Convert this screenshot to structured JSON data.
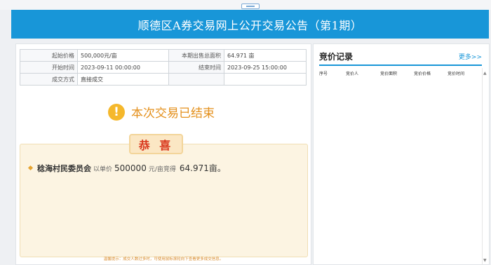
{
  "header": {
    "title": "顺德区A券交易网上公开交易公告（第1期）"
  },
  "info_table": {
    "rows": [
      {
        "label1": "起始价格",
        "value1": "500,000元/亩",
        "label2": "本期出售总面积",
        "value2": "64.971 亩"
      },
      {
        "label1": "开始时间",
        "value1": "2023-09-11 00:00:00",
        "label2": "结束时间",
        "value2": "2023-09-25 15:00:00"
      },
      {
        "label1": "成交方式",
        "value1": "直接成交",
        "label2": "",
        "value2": ""
      }
    ]
  },
  "status": {
    "icon": "warning-icon",
    "text": "本次交易已结束"
  },
  "congrats": {
    "title": "恭 喜",
    "winner": "稔海村民委员会",
    "prefix": "以单价",
    "price": "500000",
    "unit": "元/亩竞得",
    "area": "64.971亩。",
    "tip": "温馨提示：成交人数过多时，可使用鼠标滚轮向下查看更多成交信息。"
  },
  "bid_records": {
    "title": "竞价记录",
    "more": "更多>>",
    "columns": [
      "序号",
      "竞价人",
      "竞价面积",
      "竞价价格",
      "竞价时间"
    ]
  },
  "colors": {
    "brand": "#1896d8",
    "accent": "#e4901c",
    "congrats_red": "#d9371d"
  }
}
